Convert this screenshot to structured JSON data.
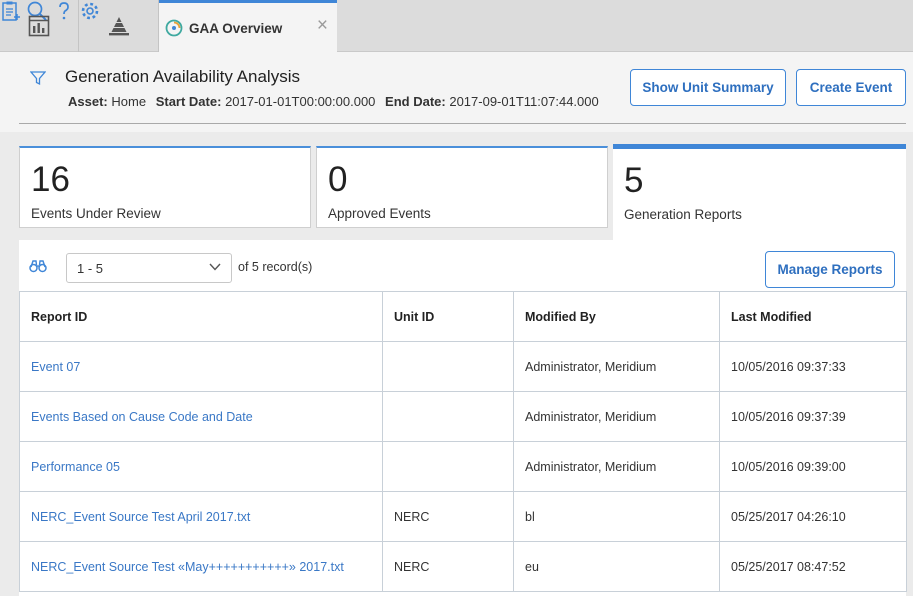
{
  "tabs": {
    "active_label": "GAA Overview",
    "close_symbol": "×"
  },
  "header": {
    "title": "Generation Availability Analysis",
    "asset_label": "Asset:",
    "asset_value": "Home",
    "start_label": "Start Date:",
    "start_value": "2017-01-01T00:00:00.000",
    "end_label": "End Date:",
    "end_value": "2017-09-01T11:07:44.000",
    "show_unit_summary": "Show Unit Summary",
    "create_event": "Create Event"
  },
  "cards": [
    {
      "count": "16",
      "label": "Events Under Review"
    },
    {
      "count": "0",
      "label": "Approved Events"
    },
    {
      "count": "5",
      "label": "Generation Reports"
    }
  ],
  "pager": {
    "range": "1 - 5",
    "of_text": "of  5  record(s)",
    "manage_reports": "Manage Reports"
  },
  "table": {
    "headers": [
      "Report ID",
      "Unit ID",
      "Modified By",
      "Last Modified"
    ],
    "rows": [
      [
        "Event 07",
        "",
        "Administrator, Meridium",
        "10/05/2016 09:37:33"
      ],
      [
        "Events Based on Cause Code and Date",
        "",
        "Administrator, Meridium",
        "10/05/2016 09:37:39"
      ],
      [
        "Performance 05",
        "",
        "Administrator, Meridium",
        "10/05/2016 09:39:00"
      ],
      [
        "NERC_Event Source Test April 2017.txt",
        "NERC",
        "bl",
        "05/25/2017 04:26:10"
      ],
      [
        "NERC_Event Source Test «May+++++++++++» 2017.txt",
        "NERC",
        "eu",
        "05/25/2017 08:47:52"
      ]
    ]
  },
  "colors": {
    "accent": "#3f86d7",
    "link": "#3a78c6"
  },
  "icons": [
    "dashboard-icon",
    "pyramid-icon",
    "gaa-icon",
    "clipboard-icon",
    "search-icon",
    "help-icon",
    "gear-icon",
    "filter-icon",
    "binoculars-icon",
    "chevron-down-icon"
  ]
}
